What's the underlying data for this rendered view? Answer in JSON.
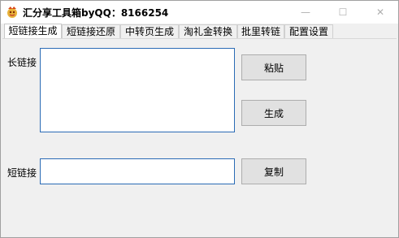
{
  "window": {
    "title": "汇分享工具箱byQQ：8166254",
    "minimize_glyph": "—",
    "maximize_glyph": "☐",
    "close_glyph": "✕"
  },
  "tabs": [
    {
      "label": "短链接生成",
      "active": true
    },
    {
      "label": "短链接还原",
      "active": false
    },
    {
      "label": "中转页生成",
      "active": false
    },
    {
      "label": "淘礼金转换",
      "active": false
    },
    {
      "label": "批里转链",
      "active": false
    },
    {
      "label": "配置设置",
      "active": false
    }
  ],
  "form": {
    "long_link_label": "长链接",
    "long_link_value": "",
    "short_link_label": "短链接",
    "short_link_value": "",
    "paste_button": "粘贴",
    "generate_button": "生成",
    "copy_button": "复制"
  },
  "colors": {
    "accent_border": "#2a6bb5",
    "button_bg": "#e1e1e1"
  }
}
